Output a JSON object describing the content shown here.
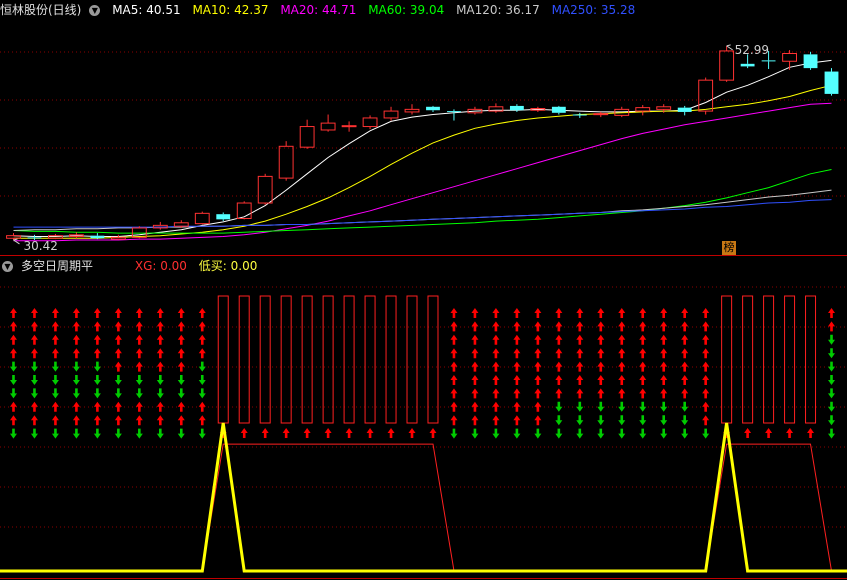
{
  "top_header": {
    "title": "恒林股份(日线)",
    "ma": [
      {
        "label": "MA5: 40.51",
        "color": "#ffffff"
      },
      {
        "label": "MA10: 42.37",
        "color": "#ffff00"
      },
      {
        "label": "MA20: 44.71",
        "color": "#ff00ff"
      },
      {
        "label": "MA60: 39.04",
        "color": "#00ff00"
      },
      {
        "label": "MA120: 36.17",
        "color": "#c8c8c8"
      },
      {
        "label": "MA250: 35.28",
        "color": "#3050ff"
      }
    ]
  },
  "bottom_header": {
    "title": "多空日周期平",
    "xg": {
      "label": "XG: 0.00",
      "color": "#ff3030"
    },
    "buy": {
      "label": "低买: 0.00",
      "color": "#ffff40"
    }
  },
  "annotations": {
    "high_label": "52.99",
    "low_label": "30.42",
    "badge": "榜"
  },
  "colors": {
    "up": "#ff3232",
    "down": "#54ffff",
    "grid": "#8b0000",
    "arrow_up": "#ff0000",
    "arrow_down": "#00cc00",
    "signal": "#ffff00",
    "box": "#ff2020"
  },
  "chart_data": [
    {
      "type": "candlestick",
      "price_range": [
        29,
        56
      ],
      "candles": [
        {
          "o": 30.6,
          "c": 30.9,
          "h": 31.2,
          "l": 30.4
        },
        {
          "o": 30.7,
          "c": 30.6,
          "h": 31.0,
          "l": 30.4
        },
        {
          "o": 30.6,
          "c": 30.9,
          "h": 31.1,
          "l": 30.5
        },
        {
          "o": 30.8,
          "c": 31.0,
          "h": 31.3,
          "l": 30.6
        },
        {
          "o": 30.9,
          "c": 30.6,
          "h": 31.2,
          "l": 30.5
        },
        {
          "o": 30.5,
          "c": 30.7,
          "h": 31.0,
          "l": 30.42
        },
        {
          "o": 30.7,
          "c": 31.8,
          "h": 32.0,
          "l": 30.6
        },
        {
          "o": 31.8,
          "c": 32.1,
          "h": 32.5,
          "l": 31.6
        },
        {
          "o": 32.0,
          "c": 32.4,
          "h": 32.7,
          "l": 31.8
        },
        {
          "o": 32.3,
          "c": 33.5,
          "h": 33.7,
          "l": 32.2
        },
        {
          "o": 33.4,
          "c": 32.8,
          "h": 33.6,
          "l": 32.6
        },
        {
          "o": 32.9,
          "c": 34.7,
          "h": 34.9,
          "l": 32.8
        },
        {
          "o": 34.7,
          "c": 37.8,
          "h": 38.1,
          "l": 34.5
        },
        {
          "o": 37.6,
          "c": 41.3,
          "h": 41.9,
          "l": 37.3
        },
        {
          "o": 41.2,
          "c": 43.6,
          "h": 44.4,
          "l": 41.0
        },
        {
          "o": 43.2,
          "c": 44.0,
          "h": 45.0,
          "l": 43.0
        },
        {
          "o": 43.6,
          "c": 43.7,
          "h": 44.2,
          "l": 43.0
        },
        {
          "o": 43.6,
          "c": 44.6,
          "h": 44.9,
          "l": 43.3
        },
        {
          "o": 44.6,
          "c": 45.4,
          "h": 45.9,
          "l": 44.3
        },
        {
          "o": 45.3,
          "c": 45.6,
          "h": 46.2,
          "l": 45.0
        },
        {
          "o": 45.9,
          "c": 45.5,
          "h": 46.0,
          "l": 45.3
        },
        {
          "o": 45.4,
          "c": 45.3,
          "h": 45.6,
          "l": 44.3
        },
        {
          "o": 45.2,
          "c": 45.6,
          "h": 45.9,
          "l": 45.0
        },
        {
          "o": 45.4,
          "c": 45.9,
          "h": 46.3,
          "l": 45.2
        },
        {
          "o": 46.0,
          "c": 45.5,
          "h": 46.2,
          "l": 45.3
        },
        {
          "o": 45.5,
          "c": 45.7,
          "h": 45.9,
          "l": 45.3
        },
        {
          "o": 45.9,
          "c": 45.2,
          "h": 46.0,
          "l": 45.0
        },
        {
          "o": 45.0,
          "c": 44.9,
          "h": 45.2,
          "l": 44.6
        },
        {
          "o": 45.0,
          "c": 45.1,
          "h": 45.3,
          "l": 44.7
        },
        {
          "o": 44.9,
          "c": 45.6,
          "h": 45.9,
          "l": 44.7
        },
        {
          "o": 45.4,
          "c": 45.8,
          "h": 46.1,
          "l": 44.9
        },
        {
          "o": 45.6,
          "c": 45.9,
          "h": 46.2,
          "l": 45.2
        },
        {
          "o": 45.8,
          "c": 45.3,
          "h": 46.0,
          "l": 44.9
        },
        {
          "o": 45.4,
          "c": 49.0,
          "h": 49.3,
          "l": 45.0
        },
        {
          "o": 49.0,
          "c": 52.4,
          "h": 52.99,
          "l": 48.8
        },
        {
          "o": 50.9,
          "c": 50.6,
          "h": 52.0,
          "l": 50.4
        },
        {
          "o": 51.3,
          "c": 51.2,
          "h": 52.4,
          "l": 50.3
        },
        {
          "o": 51.2,
          "c": 52.1,
          "h": 52.5,
          "l": 50.2
        },
        {
          "o": 52.0,
          "c": 50.4,
          "h": 52.3,
          "l": 50.2
        },
        {
          "o": 50.0,
          "c": 47.4,
          "h": 50.4,
          "l": 47.2
        }
      ],
      "moving_averages": [
        {
          "name": "MA5",
          "color": "#ffffff",
          "values": [
            30.9,
            30.8,
            30.8,
            30.9,
            30.8,
            30.8,
            31.0,
            31.3,
            31.6,
            32.1,
            32.5,
            33.1,
            34.4,
            36.2,
            38.1,
            40.0,
            41.6,
            43.1,
            44.2,
            44.7,
            45.0,
            45.2,
            45.4,
            45.5,
            45.5,
            45.6,
            45.5,
            45.4,
            45.3,
            45.3,
            45.4,
            45.4,
            45.5,
            46.4,
            47.6,
            48.4,
            49.4,
            50.5,
            51.0,
            51.3
          ]
        },
        {
          "name": "MA10",
          "color": "#ffff00",
          "values": [
            30.6,
            30.6,
            30.6,
            30.6,
            30.6,
            30.7,
            30.8,
            30.9,
            31.1,
            31.3,
            31.6,
            32.0,
            32.6,
            33.4,
            34.3,
            35.3,
            36.5,
            37.8,
            39.2,
            40.5,
            41.7,
            42.6,
            43.4,
            43.9,
            44.3,
            44.6,
            44.8,
            45.0,
            45.1,
            45.2,
            45.3,
            45.4,
            45.4,
            45.6,
            45.9,
            46.2,
            46.6,
            47.1,
            47.8,
            48.4
          ]
        },
        {
          "name": "MA20",
          "color": "#ff00ff",
          "values": [
            30.3,
            30.3,
            30.3,
            30.4,
            30.4,
            30.4,
            30.5,
            30.5,
            30.6,
            30.7,
            30.8,
            31.0,
            31.3,
            31.7,
            32.1,
            32.6,
            33.2,
            33.8,
            34.5,
            35.2,
            35.9,
            36.6,
            37.3,
            38.0,
            38.7,
            39.4,
            40.1,
            40.8,
            41.5,
            42.2,
            42.8,
            43.3,
            43.8,
            44.2,
            44.6,
            45.0,
            45.4,
            45.8,
            46.2,
            46.3
          ]
        },
        {
          "name": "MA60",
          "color": "#00ff00",
          "values": [
            31.5,
            31.4,
            31.4,
            31.3,
            31.3,
            31.2,
            31.2,
            31.2,
            31.2,
            31.2,
            31.2,
            31.3,
            31.4,
            31.5,
            31.6,
            31.7,
            31.8,
            31.9,
            32.0,
            32.1,
            32.2,
            32.3,
            32.4,
            32.6,
            32.7,
            32.8,
            33.0,
            33.2,
            33.4,
            33.6,
            33.8,
            34.1,
            34.4,
            34.8,
            35.3,
            35.9,
            36.5,
            37.3,
            38.1,
            38.6
          ]
        },
        {
          "name": "MA120",
          "color": "#c8c8c8",
          "values": [
            31.5,
            31.6,
            31.6,
            31.7,
            31.7,
            31.8,
            31.8,
            31.9,
            31.9,
            32.0,
            32.0,
            32.1,
            32.1,
            32.2,
            32.2,
            32.3,
            32.4,
            32.5,
            32.6,
            32.7,
            32.8,
            32.9,
            33.0,
            33.1,
            33.2,
            33.3,
            33.4,
            33.5,
            33.6,
            33.8,
            33.9,
            34.1,
            34.3,
            34.5,
            34.8,
            35.1,
            35.4,
            35.6,
            35.9,
            36.2
          ]
        },
        {
          "name": "MA250",
          "color": "#3050ff",
          "values": [
            31.9,
            31.9,
            31.9,
            31.9,
            31.9,
            31.9,
            31.9,
            31.9,
            32.0,
            32.0,
            32.0,
            32.1,
            32.1,
            32.2,
            32.2,
            32.3,
            32.4,
            32.5,
            32.6,
            32.7,
            32.8,
            32.9,
            33.0,
            33.1,
            33.2,
            33.3,
            33.4,
            33.5,
            33.6,
            33.7,
            33.8,
            33.9,
            34.0,
            34.2,
            34.3,
            34.5,
            34.7,
            34.8,
            35.0,
            35.1
          ]
        }
      ]
    },
    {
      "type": "indicator",
      "range": [
        0,
        7
      ],
      "arrow_columns": [
        [
          "up",
          "up",
          "up",
          "up",
          "dn",
          "dn",
          "dn",
          "up",
          "up",
          "dn"
        ],
        [
          "up",
          "up",
          "up",
          "up",
          "dn",
          "dn",
          "dn",
          "up",
          "up",
          "dn"
        ],
        [
          "up",
          "up",
          "up",
          "up",
          "dn",
          "dn",
          "dn",
          "up",
          "up",
          "dn"
        ],
        [
          "up",
          "up",
          "up",
          "up",
          "dn",
          "dn",
          "dn",
          "up",
          "up",
          "dn"
        ],
        [
          "up",
          "up",
          "up",
          "up",
          "dn",
          "dn",
          "dn",
          "up",
          "up",
          "dn"
        ],
        [
          "up",
          "up",
          "up",
          "up",
          "up",
          "dn",
          "dn",
          "up",
          "up",
          "dn"
        ],
        [
          "up",
          "up",
          "up",
          "up",
          "up",
          "dn",
          "dn",
          "up",
          "up",
          "dn"
        ],
        [
          "up",
          "up",
          "up",
          "up",
          "up",
          "dn",
          "dn",
          "up",
          "up",
          "dn"
        ],
        [
          "up",
          "up",
          "up",
          "up",
          "up",
          "dn",
          "dn",
          "up",
          "up",
          "dn"
        ],
        [
          "up",
          "up",
          "up",
          "up",
          "dn",
          "dn",
          "dn",
          "up",
          "up",
          "dn"
        ],
        "box",
        "box",
        "box",
        "box",
        "box",
        "box",
        "box",
        "box",
        "box",
        "box",
        "box",
        [
          "up",
          "up",
          "up",
          "up",
          "up",
          "up",
          "up",
          "up",
          "up",
          "dn"
        ],
        [
          "up",
          "up",
          "up",
          "up",
          "up",
          "up",
          "up",
          "up",
          "up",
          "dn"
        ],
        [
          "up",
          "up",
          "up",
          "up",
          "up",
          "up",
          "up",
          "up",
          "up",
          "dn"
        ],
        [
          "up",
          "up",
          "up",
          "up",
          "up",
          "up",
          "up",
          "up",
          "up",
          "dn"
        ],
        [
          "up",
          "up",
          "up",
          "up",
          "up",
          "up",
          "up",
          "up",
          "up",
          "dn"
        ],
        [
          "up",
          "up",
          "up",
          "up",
          "up",
          "up",
          "up",
          "dn",
          "dn",
          "dn"
        ],
        [
          "up",
          "up",
          "up",
          "up",
          "up",
          "up",
          "up",
          "dn",
          "dn",
          "dn"
        ],
        [
          "up",
          "up",
          "up",
          "up",
          "up",
          "up",
          "up",
          "dn",
          "dn",
          "dn"
        ],
        [
          "up",
          "up",
          "up",
          "up",
          "up",
          "up",
          "up",
          "dn",
          "dn",
          "dn"
        ],
        [
          "up",
          "up",
          "up",
          "up",
          "up",
          "up",
          "up",
          "dn",
          "dn",
          "dn"
        ],
        [
          "up",
          "up",
          "up",
          "up",
          "up",
          "up",
          "up",
          "dn",
          "dn",
          "dn"
        ],
        [
          "up",
          "up",
          "up",
          "up",
          "up",
          "up",
          "up",
          "dn",
          "dn",
          "dn"
        ],
        [
          "up",
          "up",
          "up",
          "up",
          "up",
          "up",
          "up",
          "up",
          "up",
          "dn"
        ],
        "box",
        "box",
        "box",
        "box",
        "box",
        [
          "up",
          "up",
          "dn",
          "dn",
          "dn",
          "dn",
          "dn",
          "dn",
          "dn",
          "dn"
        ]
      ],
      "signal_line": [
        0,
        0,
        0,
        0,
        0,
        0,
        0,
        0,
        0,
        0,
        7,
        0,
        0,
        0,
        0,
        0,
        0,
        0,
        0,
        0,
        0,
        0,
        0,
        0,
        0,
        0,
        0,
        0,
        0,
        0,
        0,
        0,
        0,
        0,
        7,
        0,
        0,
        0,
        0,
        0
      ],
      "box_line": [
        0,
        0,
        0,
        0,
        0,
        0,
        0,
        0,
        0,
        0,
        6,
        6,
        6,
        6,
        6,
        6,
        6,
        6,
        6,
        6,
        6,
        0,
        0,
        0,
        0,
        0,
        0,
        0,
        0,
        0,
        0,
        0,
        0,
        0,
        6,
        6,
        6,
        6,
        6,
        0
      ]
    }
  ]
}
